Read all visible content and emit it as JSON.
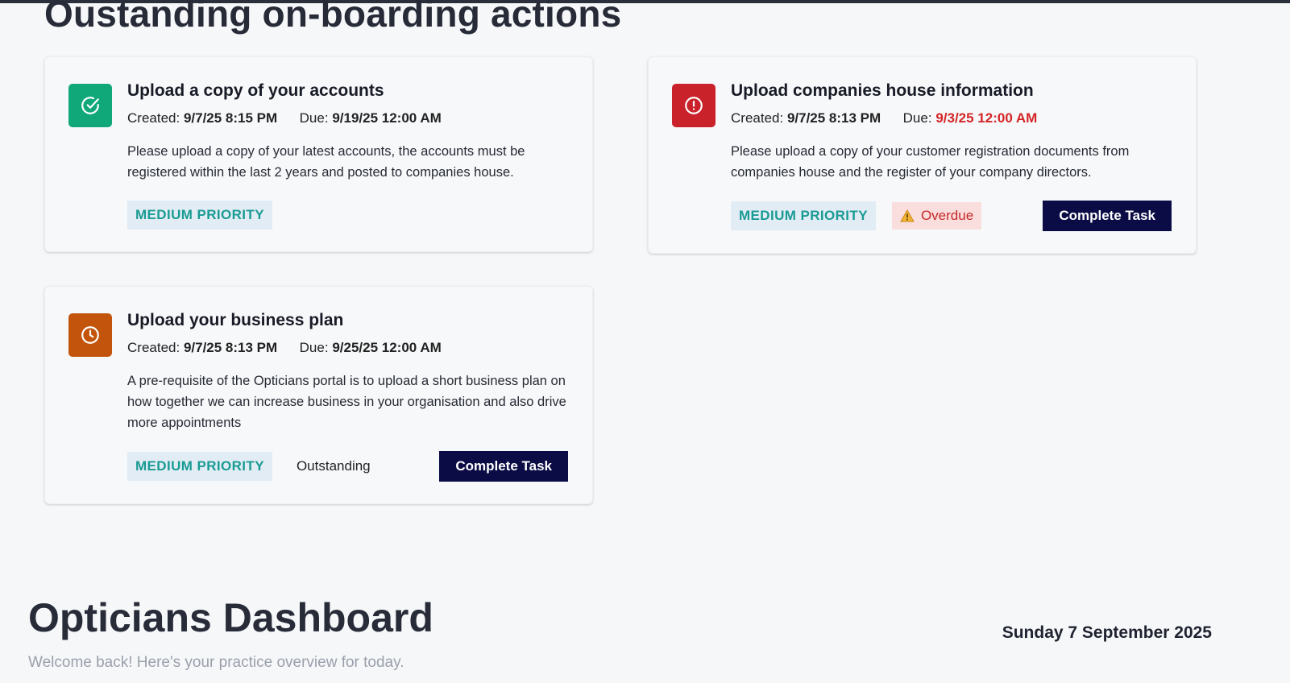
{
  "section": {
    "title": "Oustanding on-boarding actions"
  },
  "labels": {
    "created": "Created:",
    "due": "Due:"
  },
  "tasks": [
    {
      "icon": "check-circle-icon",
      "icon_color": "#10a879",
      "title": "Upload a copy of your accounts",
      "created": "9/7/25 8:15 PM",
      "due": "9/19/25 12:00 AM",
      "description": "Please upload a copy of your latest accounts, the accounts must be registered within the last 2 years and posted to companies house.",
      "priority": "MEDIUM PRIORITY"
    },
    {
      "icon": "alert-circle-icon",
      "icon_color": "#c9222a",
      "title": "Upload companies house information",
      "created": "9/7/25 8:13 PM",
      "due": "9/3/25 12:00 AM",
      "description": "Please upload a copy of your customer registration documents from companies house and the register of your company directors.",
      "priority": "MEDIUM PRIORITY",
      "status": "Overdue",
      "button": "Complete Task"
    },
    {
      "icon": "clock-icon",
      "icon_color": "#c2550b",
      "title": "Upload your business plan",
      "created": "9/7/25 8:13 PM",
      "due": "9/25/25 12:00 AM",
      "description": "A pre-requisite of the Opticians portal is to upload a short business plan on how together we can increase business in your organisation and also drive more appointments",
      "priority": "MEDIUM PRIORITY",
      "status": "Outstanding",
      "button": "Complete Task"
    }
  ],
  "dashboard": {
    "title": "Opticians Dashboard",
    "date": "Sunday 7 September 2025",
    "subtitle": "Welcome back! Here's your practice overview for today."
  }
}
